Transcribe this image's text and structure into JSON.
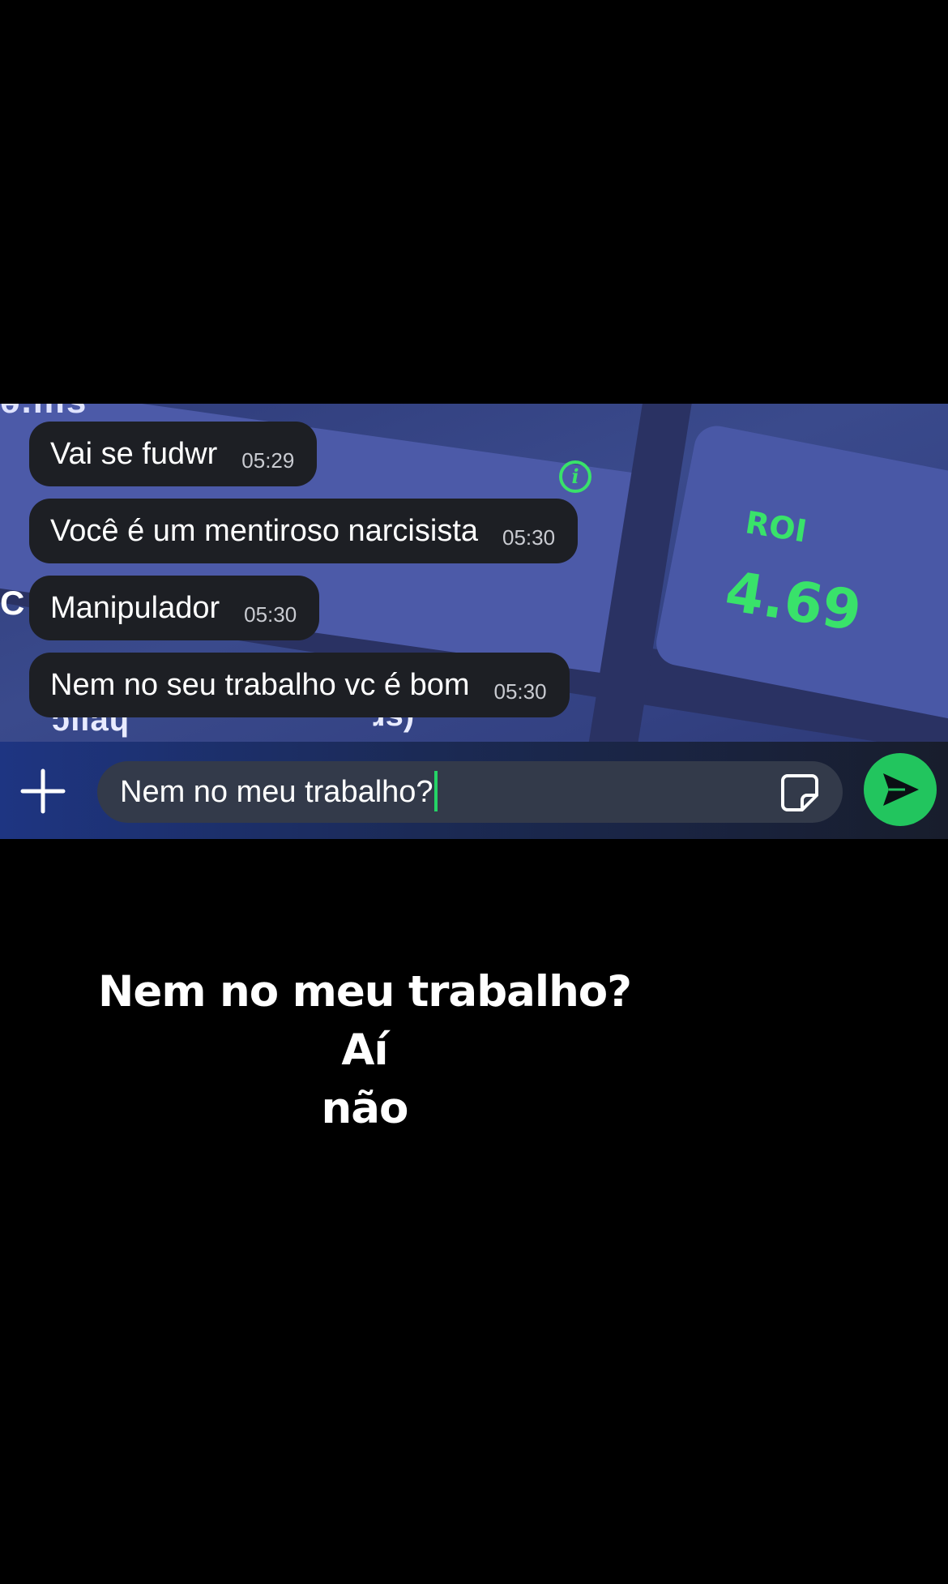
{
  "messages": [
    {
      "text": "Vai se fudwr",
      "time": "05:29"
    },
    {
      "text": "Você é um mentiroso narcisista",
      "time": "05:30"
    },
    {
      "text": "Manipulador",
      "time": "05:30"
    },
    {
      "text": "Nem no seu trabalho vc é bom",
      "time": "05:30"
    }
  ],
  "composer": {
    "value": "Nem no meu trabalho?"
  },
  "icons": {
    "plus": "plus-icon",
    "sticker": "sticker-icon",
    "send": "send-icon",
    "info": "info-icon"
  },
  "wallpaper": {
    "roi_label": "ROI",
    "roi_value": "4.69",
    "info_glyph": "i",
    "fragment_left": "C",
    "fragment_top": "ə.ms",
    "fragment_bottom": "ɔılaɥ",
    "fragment_bottom2": "ɹs)"
  },
  "caption": {
    "line1": "Nem no meu trabalho? Aí",
    "line2": "não"
  },
  "colors": {
    "accent_green": "#22c55e",
    "bubble_bg": "#1d1f24",
    "caret": "#25d366",
    "roi_green": "#39e26a"
  }
}
